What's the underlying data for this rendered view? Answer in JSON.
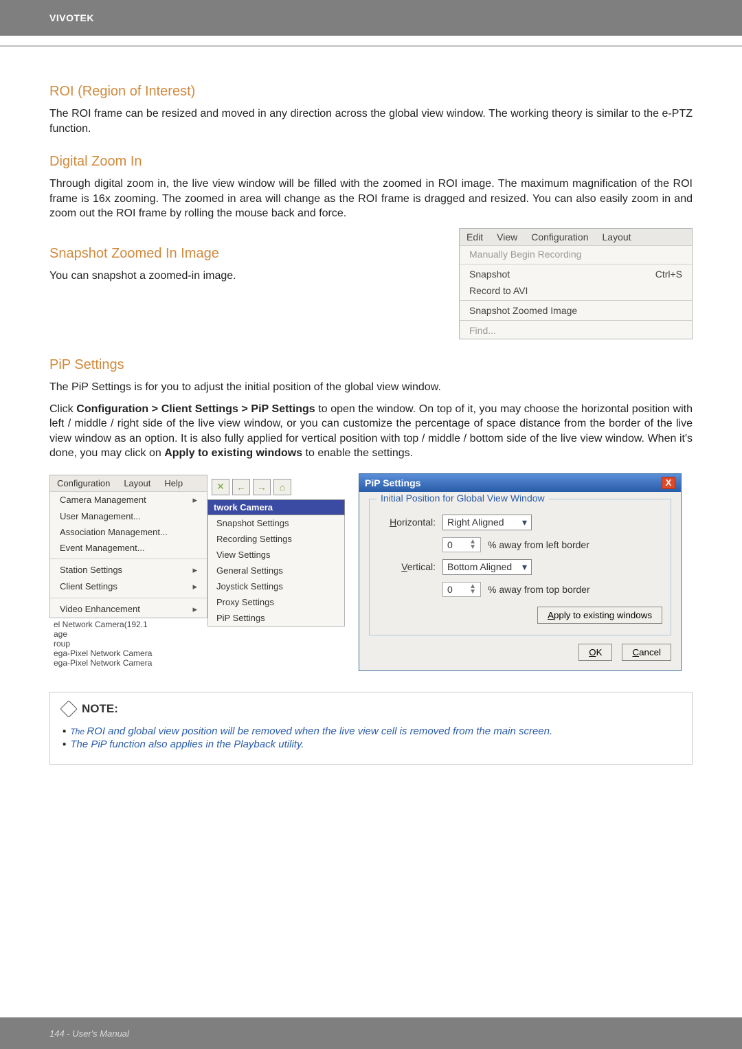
{
  "header": {
    "brand": "VIVOTEK"
  },
  "sections": {
    "roi": {
      "title": "ROI (Region of Interest)",
      "body": "The ROI frame can be resized and moved in any direction across the global view window. The working theory is similar to the e-PTZ function."
    },
    "zoom": {
      "title": "Digital Zoom In",
      "body": "Through digital zoom in, the live view window will be filled with the zoomed in ROI image. The maximum magnification of the ROI frame is 16x zooming. The zoomed in area will change as the ROI frame is dragged and resized. You can also easily zoom in and zoom out the ROI frame by rolling the mouse back and force."
    },
    "snap": {
      "title": "Snapshot Zoomed In Image",
      "body": "You can snapshot a zoomed-in image."
    },
    "pip": {
      "title": "PiP Settings",
      "body1": "The PiP Settings is for you to adjust the initial position of the global view window.",
      "body2a": "Click ",
      "body2b": "Configuration > Client Settings > PiP Settings",
      "body2c": " to open the window. On top of it, you may choose the horizontal position with left / middle / right side of the live view window, or you can customize the percentage of space distance from the border of the live view window as an option. It is also fully applied for vertical position with top / middle / bottom side of the live view window. When it's done, you may click on ",
      "body2d": "Apply to existing windows",
      "body2e": " to enable the settings."
    }
  },
  "edit_menu": {
    "bar": [
      "Edit",
      "View",
      "Configuration",
      "Layout"
    ],
    "items": [
      {
        "label": "Manually Begin Recording",
        "shortcut": "",
        "disabled": true
      },
      {
        "label": "Snapshot",
        "shortcut": "Ctrl+S"
      },
      {
        "label": "Record to AVI",
        "shortcut": ""
      },
      {
        "label": "Snapshot Zoomed Image",
        "shortcut": ""
      },
      {
        "label": "Find...",
        "shortcut": "",
        "disabled": true
      }
    ]
  },
  "config_menu": {
    "tabs": [
      "Configuration",
      "Layout",
      "Help"
    ],
    "items": [
      {
        "label": "Camera Management",
        "arrow": true
      },
      {
        "label": "User Management..."
      },
      {
        "label": "Association Management..."
      },
      {
        "label": "Event Management..."
      },
      {
        "sep": true
      },
      {
        "label": "Station Settings",
        "arrow": true
      },
      {
        "label": "Client Settings",
        "arrow": true
      },
      {
        "sep": true
      },
      {
        "label": "Video Enhancement",
        "arrow": true
      }
    ],
    "tree": [
      "el Network Camera(192.1",
      "age",
      "roup",
      "ega-Pixel Network Camera",
      "ega-Pixel Network Camera"
    ],
    "sub_head": "twork Camera",
    "sub_items": [
      "Snapshot Settings",
      "Recording Settings",
      "View Settings",
      "General Settings",
      "Joystick Settings",
      "Proxy Settings",
      "PiP Settings"
    ]
  },
  "pip_dialog": {
    "title": "PiP Settings",
    "legend": "Initial Position for Global View Window",
    "h_label": "Horizontal:",
    "h_combo": "Right Aligned",
    "h_spin": "0",
    "h_suffix": "% away from left border",
    "v_label": "Vertical:",
    "v_combo": "Bottom Aligned",
    "v_spin": "0",
    "v_suffix": "% away from top border",
    "apply": "Apply to existing windows",
    "ok": "OK",
    "cancel": "Cancel"
  },
  "note": {
    "head": "NOTE:",
    "line1_pre": "The ",
    "line1": "ROI and global view position will be removed when the live view cell is removed from the main screen.",
    "line2": "The PiP function also applies in the Playback utility."
  },
  "footer": {
    "text": "144 - User's Manual"
  }
}
